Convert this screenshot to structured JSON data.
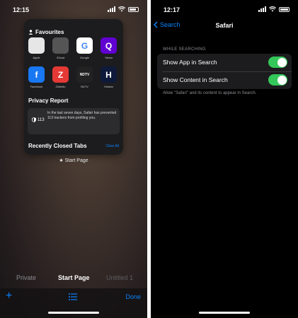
{
  "left": {
    "status_time": "12:15",
    "card": {
      "favourites_title": "Favourites",
      "favourites": [
        {
          "label": "Apple",
          "glyph": "",
          "bg": "#e6e6e6",
          "fg": "#000"
        },
        {
          "label": "iCloud",
          "glyph": "",
          "bg": "#555",
          "fg": "#ddd"
        },
        {
          "label": "Google",
          "glyph": "G",
          "bg": "#ffffff",
          "fg": "#4285f4"
        },
        {
          "label": "Yahoo",
          "glyph": "Q",
          "bg": "#6001d2",
          "fg": "#fff"
        },
        {
          "label": "Facebook",
          "glyph": "f",
          "bg": "#1877f2",
          "fg": "#fff"
        },
        {
          "label": "Zinbello",
          "glyph": "Z",
          "bg": "#e53935",
          "fg": "#fff"
        },
        {
          "label": "NDTV",
          "glyph": "NDTV",
          "bg": "#222",
          "fg": "#fff"
        },
        {
          "label": "Hotstar",
          "glyph": "H",
          "bg": "#0f1a3a",
          "fg": "#fff"
        }
      ],
      "privacy_title": "Privacy Report",
      "privacy_count": "113",
      "privacy_text": "In the last seven days, Safari has prevented 113 trackers from profiling you.",
      "recent_title": "Recently Closed Tabs",
      "clear_all": "Clear All"
    },
    "caption": "Start Page",
    "tabs": {
      "private": "Private",
      "start": "Start Page",
      "untitled": "Untitled 1"
    },
    "done": "Done",
    "accent": "#0a84ff"
  },
  "right": {
    "status_time": "12:17",
    "back_label": "Search",
    "title": "Safari",
    "section_header": "WHILE SEARCHING",
    "rows": [
      {
        "label": "Show App in Search",
        "on": true
      },
      {
        "label": "Show Content in Search",
        "on": true
      }
    ],
    "footer": "Allow \"Safari\" and its content to appear in Search.",
    "toggle_color": "#34c759"
  }
}
